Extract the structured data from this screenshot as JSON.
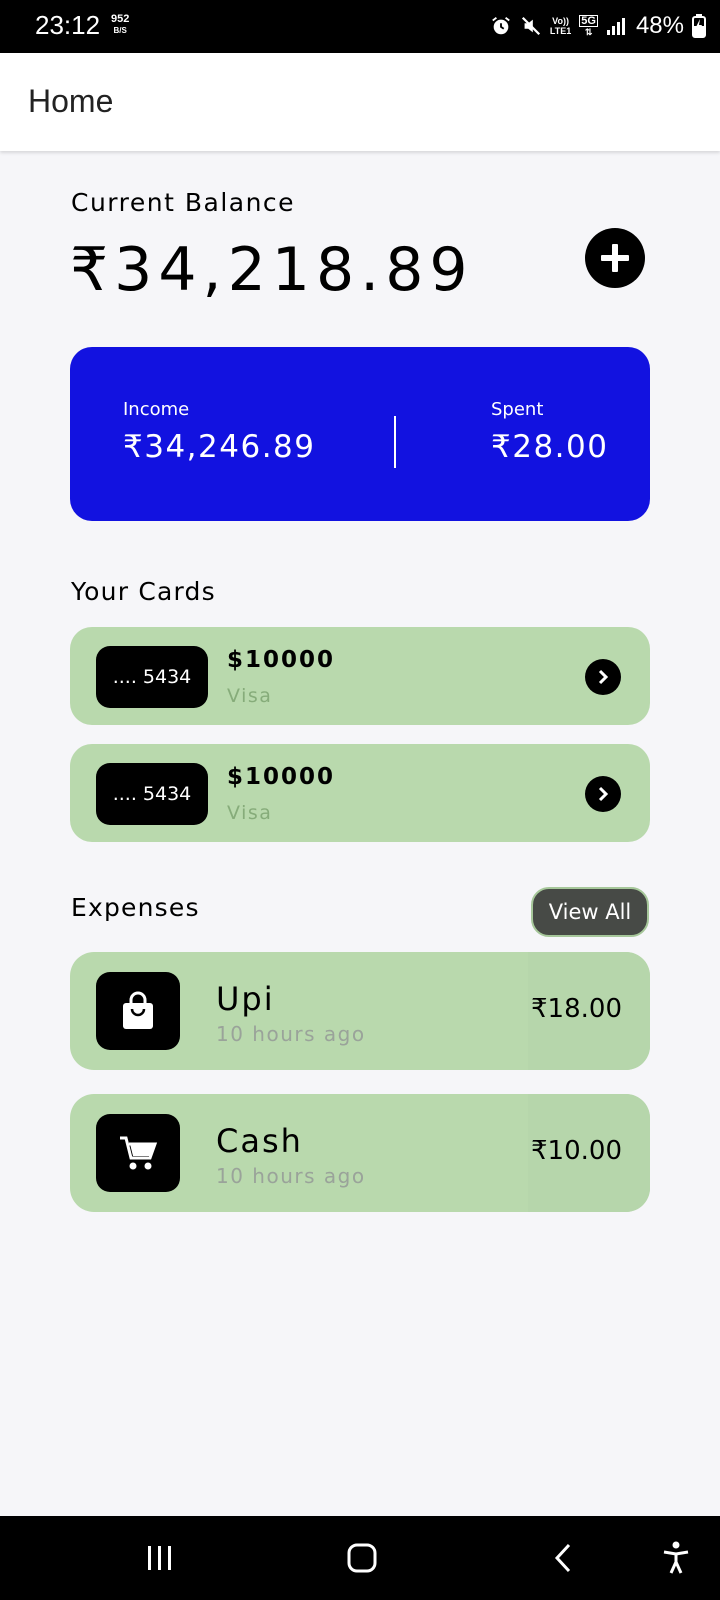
{
  "status_bar": {
    "time": "23:12",
    "speed_value": "952",
    "speed_unit": "B/S",
    "network_top": "Vo))",
    "network_bottom": "LTE1",
    "network_gen": "5G",
    "battery": "48%"
  },
  "app_bar": {
    "title": "Home"
  },
  "balance": {
    "label": "Current Balance",
    "value": "₹34,218.89"
  },
  "summary": {
    "income_label": "Income",
    "income_value": "₹34,246.89",
    "spent_label": "Spent",
    "spent_value": "₹28.00",
    "background_color": "#1212e0"
  },
  "cards_section": {
    "title": "Your Cards",
    "cards": [
      {
        "masked_number": ".... 5434",
        "amount": "$10000",
        "type": "Visa"
      },
      {
        "masked_number": ".... 5434",
        "amount": "$10000",
        "type": "Visa"
      }
    ]
  },
  "expenses_section": {
    "title": "Expenses",
    "view_all_label": "View All",
    "items": [
      {
        "icon": "shopping-bag-icon",
        "name": "Upi",
        "time": "10 hours ago",
        "amount": "₹18.00"
      },
      {
        "icon": "cart-icon",
        "name": "Cash",
        "time": "10 hours ago",
        "amount": "₹10.00"
      }
    ]
  },
  "colors": {
    "card_green": "#b9d9ad",
    "accent_blue": "#1212e0"
  }
}
